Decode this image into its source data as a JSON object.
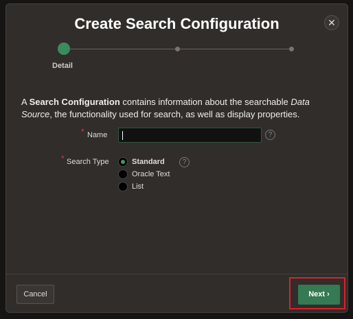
{
  "dialog": {
    "title": "Create Search Configuration",
    "close_label": "✕"
  },
  "wizard": {
    "steps": [
      {
        "label": "Detail",
        "active": true
      },
      {
        "label": "",
        "active": false
      },
      {
        "label": "",
        "active": false
      }
    ],
    "accent": "#3a8c5e"
  },
  "description": {
    "p1": "A ",
    "b1": "Search Configuration",
    "p2": " contains information about the searchable ",
    "i1": "Data Source",
    "p3": ", the functionality used for search, as well as display properties."
  },
  "form": {
    "name": {
      "label": "Name",
      "required": "*",
      "value": "",
      "help": "?"
    },
    "search_type": {
      "label": "Search Type",
      "required": "*",
      "help": "?",
      "options": [
        "Standard",
        "Oracle Text",
        "List"
      ],
      "selected": "Standard"
    }
  },
  "footer": {
    "cancel": "Cancel",
    "next": "Next",
    "next_icon": "›"
  }
}
